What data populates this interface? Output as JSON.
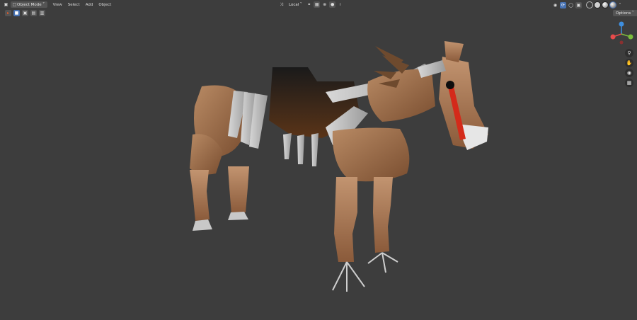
{
  "header": {
    "editor_type_icon": "camera-icon",
    "mode_label": "Object Mode",
    "menus": [
      "View",
      "Select",
      "Add",
      "Object"
    ],
    "transform_orientation": "Local",
    "options_label": "Options"
  },
  "tool_icons": [
    "cursor-icon",
    "select-box-icon",
    "select-extend-icon",
    "select-subtract-icon",
    "select-invert-icon"
  ],
  "navigation": {
    "gizmo_axes": [
      "X",
      "Y",
      "Z"
    ],
    "buttons": [
      "zoom-icon",
      "hand-pan-icon",
      "camera-view-icon",
      "grid-ortho-icon"
    ]
  },
  "colors": {
    "viewport_bg": "#3d3d3d",
    "active_blue": "#4772b3",
    "axis_x": "#e84b4b",
    "axis_y": "#7bbd3c",
    "axis_z": "#3e8fe0"
  }
}
